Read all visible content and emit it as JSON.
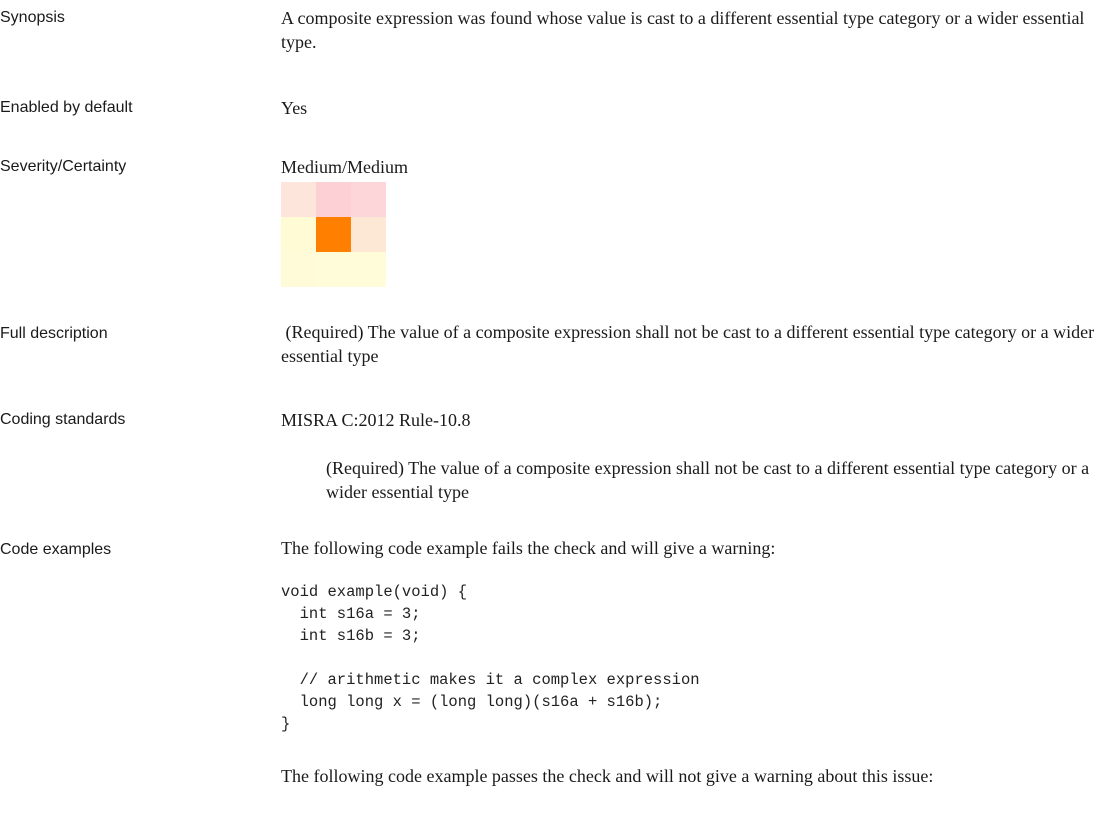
{
  "rows": {
    "synopsis": {
      "label": "Synopsis",
      "value": "A composite expression was found whose value is cast to a different essential type category or a wider essential type."
    },
    "enabled": {
      "label": "Enabled by default",
      "value": "Yes"
    },
    "severity": {
      "label": "Severity/Certainty",
      "value": "Medium/Medium",
      "matrix": {
        "colors": [
          [
            "#fde5dc",
            "#fdd0d6",
            "#fdd6da"
          ],
          [
            "#fffbd5",
            "#ff7f00",
            "#fde8d6"
          ],
          [
            "#fffbd8",
            "#fffcda",
            "#fffcda"
          ]
        ],
        "highlighted_cell": "row 2, column 2"
      }
    },
    "full_description": {
      "label": "Full description",
      "value": " (Required) The value of a composite expression shall not be cast to a different essential type category or a wider essential type"
    },
    "coding_standards": {
      "label": "Coding standards",
      "value": "MISRA C:2012 Rule-10.8",
      "detail": "(Required) The value of a composite expression shall not be cast to a different essential type category or a wider essential type"
    },
    "code_examples": {
      "label": "Code examples",
      "fail_intro": "The following code example fails the check and will give a warning:",
      "fail_code": "void example(void) {\n  int s16a = 3;\n  int s16b = 3;\n\n  // arithmetic makes it a complex expression\n  long long x = (long long)(s16a + s16b);\n}",
      "pass_intro": "The following code example passes the check and will not give a warning about this issue:"
    }
  }
}
